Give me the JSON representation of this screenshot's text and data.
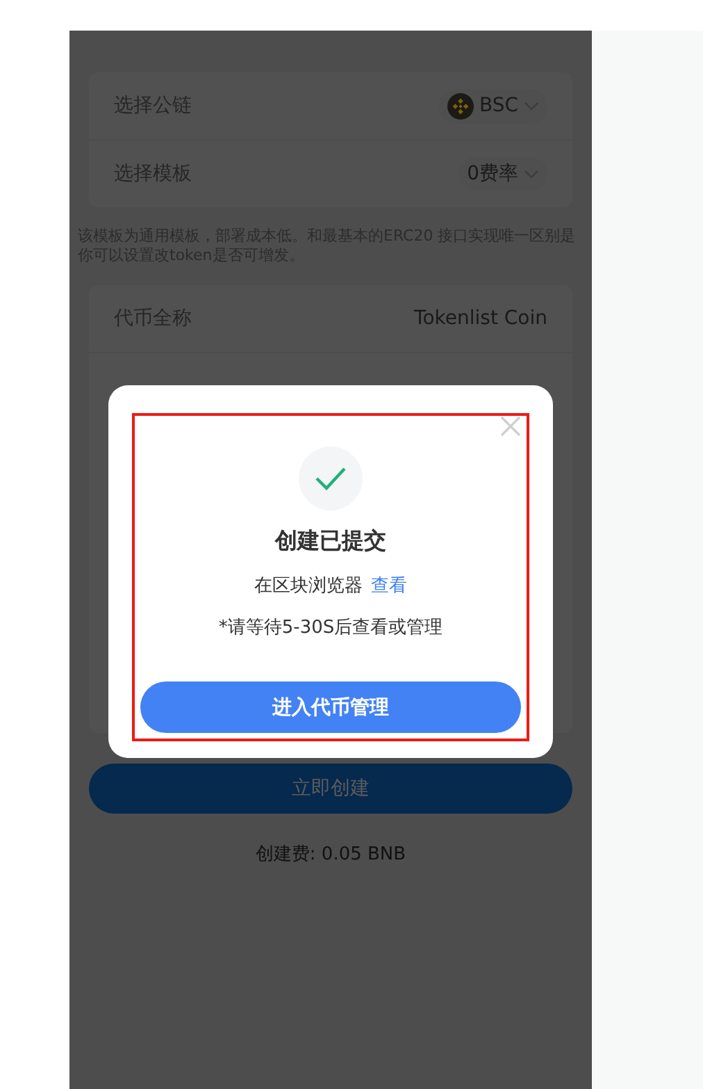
{
  "chain_settings": [
    {
      "label": "选择公链",
      "value": "BSC",
      "kind": "coin-select"
    },
    {
      "label": "选择模板",
      "value": "0费率",
      "kind": "select"
    }
  ],
  "template_note": "该模板为通用模板，部署成本低。和最基本的ERC20 接口实现唯一区别是你可以设置改token是否可增发。",
  "token_fields": [
    {
      "label": "代币全称",
      "value": "Tokenlist Coin",
      "kind": "text"
    }
  ],
  "create_button": "立即创建",
  "fee": "创建费: 0.05 BNB",
  "dialog": {
    "title": "创建已提交",
    "message": "在区块浏览器",
    "link": "查看",
    "note": "*请等待5-30S后查看或管理",
    "button": "进入代币管理",
    "highlighted": true
  }
}
